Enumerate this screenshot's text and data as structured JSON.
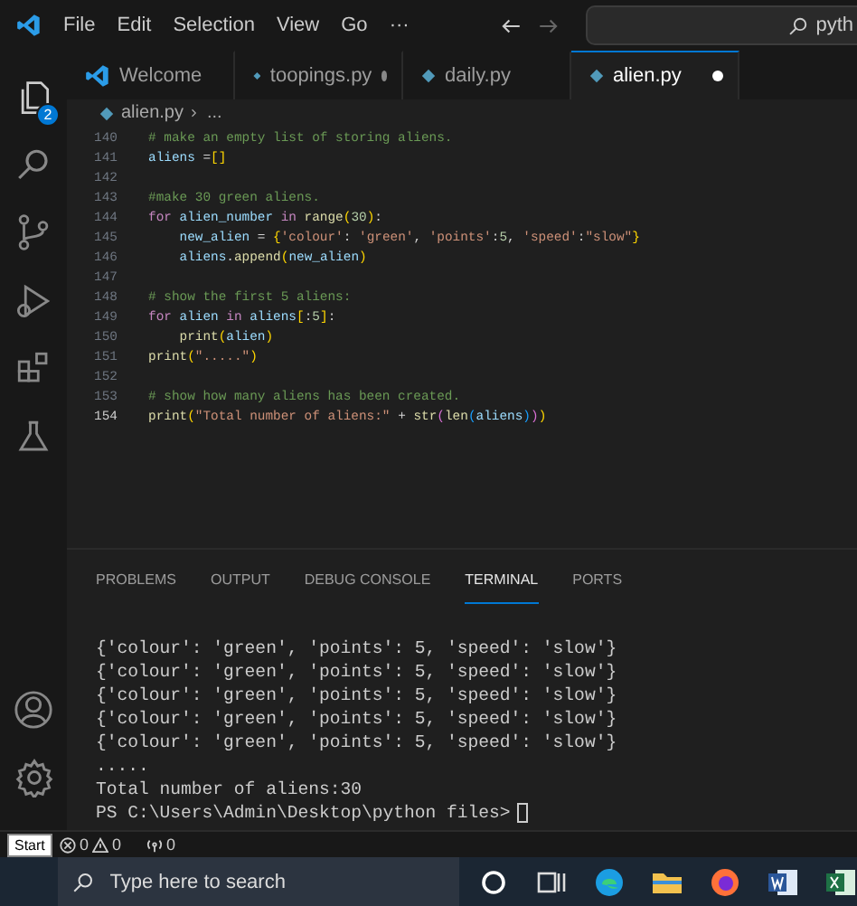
{
  "title_bar": {
    "menus": [
      "File",
      "Edit",
      "Selection",
      "View",
      "Go",
      "···"
    ],
    "search": {
      "value": "pyth"
    }
  },
  "activity_bar": {
    "top": [
      {
        "kind": "files",
        "badge": "2"
      },
      {
        "kind": "search"
      },
      {
        "kind": "source-control"
      },
      {
        "kind": "run"
      },
      {
        "kind": "extensions"
      },
      {
        "kind": "testing"
      }
    ],
    "bottom": [
      {
        "kind": "account"
      },
      {
        "kind": "settings"
      }
    ]
  },
  "tabs": [
    {
      "label": "Welcome",
      "kind": "welcome",
      "selected": false,
      "modified": false
    },
    {
      "label": "toopings.py",
      "kind": "python",
      "selected": false,
      "modified": true
    },
    {
      "label": "daily.py",
      "kind": "python",
      "selected": false,
      "modified": false
    },
    {
      "label": "alien.py",
      "kind": "python",
      "selected": true,
      "modified": true
    }
  ],
  "breadcrumb": [
    "alien.py",
    "..."
  ],
  "editor": {
    "lines": [
      {
        "number": "140",
        "current": false,
        "tokens": [
          {
            "kind": "com",
            "text": "# make an empty list of storing aliens."
          }
        ]
      },
      {
        "number": "141",
        "current": false,
        "tokens": [
          {
            "kind": "var",
            "text": "aliens"
          },
          {
            "kind": "op",
            "text": " ="
          },
          {
            "kind": "b1",
            "text": "[]"
          }
        ]
      },
      {
        "number": "142",
        "current": false
      },
      {
        "number": "143",
        "current": false,
        "tokens": [
          {
            "kind": "com",
            "text": "#make 30 green aliens."
          }
        ]
      },
      {
        "number": "144",
        "current": false,
        "tokens": [
          {
            "kind": "kw",
            "text": "for"
          },
          {
            "kind": "var",
            "text": " alien_number"
          },
          {
            "kind": "kw",
            "text": " in"
          },
          {
            "kind": "fn",
            "text": " range"
          },
          {
            "kind": "b1",
            "text": "("
          },
          {
            "kind": "num",
            "text": "30"
          },
          {
            "kind": "b1",
            "text": ")"
          },
          {
            "kind": "op",
            "text": ":"
          }
        ]
      },
      {
        "number": "145",
        "current": false,
        "tokens": [
          {
            "kind": "var",
            "text": "    new_alien"
          },
          {
            "kind": "op",
            "text": " = "
          },
          {
            "kind": "b1",
            "text": "{"
          },
          {
            "kind": "str",
            "text": "'colour'"
          },
          {
            "kind": "op",
            "text": ": "
          },
          {
            "kind": "str",
            "text": "'green'"
          },
          {
            "kind": "op",
            "text": ", "
          },
          {
            "kind": "str",
            "text": "'points'"
          },
          {
            "kind": "op",
            "text": ":"
          },
          {
            "kind": "num",
            "text": "5"
          },
          {
            "kind": "op",
            "text": ", "
          },
          {
            "kind": "str",
            "text": "'speed'"
          },
          {
            "kind": "op",
            "text": ":"
          },
          {
            "kind": "str",
            "text": "\"slow\""
          },
          {
            "kind": "b1",
            "text": "}"
          }
        ]
      },
      {
        "number": "146",
        "current": false,
        "tokens": [
          {
            "kind": "var",
            "text": "    aliens"
          },
          {
            "kind": "op",
            "text": "."
          },
          {
            "kind": "fn",
            "text": "append"
          },
          {
            "kind": "b1",
            "text": "("
          },
          {
            "kind": "var",
            "text": "new_alien"
          },
          {
            "kind": "b1",
            "text": ")"
          }
        ]
      },
      {
        "number": "147",
        "current": false
      },
      {
        "number": "148",
        "current": false,
        "tokens": [
          {
            "kind": "com",
            "text": "# show the first 5 aliens:"
          }
        ]
      },
      {
        "number": "149",
        "current": false,
        "tokens": [
          {
            "kind": "kw",
            "text": "for"
          },
          {
            "kind": "var",
            "text": " alien"
          },
          {
            "kind": "kw",
            "text": " in"
          },
          {
            "kind": "var",
            "text": " aliens"
          },
          {
            "kind": "b1",
            "text": "["
          },
          {
            "kind": "op",
            "text": ":"
          },
          {
            "kind": "num",
            "text": "5"
          },
          {
            "kind": "b1",
            "text": "]"
          },
          {
            "kind": "op",
            "text": ":"
          }
        ]
      },
      {
        "number": "150",
        "current": false,
        "tokens": [
          {
            "kind": "fn",
            "text": "    print"
          },
          {
            "kind": "b1",
            "text": "("
          },
          {
            "kind": "var",
            "text": "alien"
          },
          {
            "kind": "b1",
            "text": ")"
          }
        ]
      },
      {
        "number": "151",
        "current": false,
        "tokens": [
          {
            "kind": "fn",
            "text": "print"
          },
          {
            "kind": "b1",
            "text": "("
          },
          {
            "kind": "str",
            "text": "\".....\""
          },
          {
            "kind": "b1",
            "text": ")"
          }
        ]
      },
      {
        "number": "152",
        "current": false
      },
      {
        "number": "153",
        "current": false,
        "tokens": [
          {
            "kind": "com",
            "text": "# show how many aliens has been created."
          }
        ]
      },
      {
        "number": "154",
        "current": true,
        "tokens": [
          {
            "kind": "fn",
            "text": "print"
          },
          {
            "kind": "b1",
            "text": "("
          },
          {
            "kind": "str",
            "text": "\"Total number of aliens:\""
          },
          {
            "kind": "op",
            "text": " + "
          },
          {
            "kind": "fn",
            "text": "str"
          },
          {
            "kind": "b2",
            "text": "("
          },
          {
            "kind": "fn",
            "text": "len"
          },
          {
            "kind": "b3",
            "text": "("
          },
          {
            "kind": "var",
            "text": "aliens"
          },
          {
            "kind": "b3",
            "text": ")"
          },
          {
            "kind": "b2",
            "text": ")"
          },
          {
            "kind": "b1",
            "text": ")"
          }
        ]
      }
    ]
  },
  "panel": {
    "tabs": [
      {
        "label": "PROBLEMS",
        "selected": false
      },
      {
        "label": "OUTPUT",
        "selected": false
      },
      {
        "label": "DEBUG CONSOLE",
        "selected": false
      },
      {
        "label": "TERMINAL",
        "selected": true
      },
      {
        "label": "PORTS",
        "selected": false
      }
    ],
    "terminal": {
      "lines": [
        "{'colour': 'green', 'points': 5, 'speed': 'slow'}",
        "{'colour': 'green', 'points': 5, 'speed': 'slow'}",
        "{'colour': 'green', 'points': 5, 'speed': 'slow'}",
        "{'colour': 'green', 'points': 5, 'speed': 'slow'}",
        "{'colour': 'green', 'points': 5, 'speed': 'slow'}",
        ".....",
        "Total number of aliens:30"
      ],
      "prompt": "PS C:\\Users\\Admin\\Desktop\\python files>"
    }
  },
  "status_bar": {
    "tooltip": "Start",
    "errors": "0",
    "warnings": "0",
    "ports": "0"
  },
  "taskbar": {
    "search": {
      "placeholder": "Type here to search"
    },
    "apps": [
      {
        "kind": "cortana"
      },
      {
        "kind": "task-view"
      },
      {
        "kind": "edge"
      },
      {
        "kind": "explorer"
      },
      {
        "kind": "firefox"
      },
      {
        "kind": "word"
      },
      {
        "kind": "excel"
      }
    ]
  }
}
